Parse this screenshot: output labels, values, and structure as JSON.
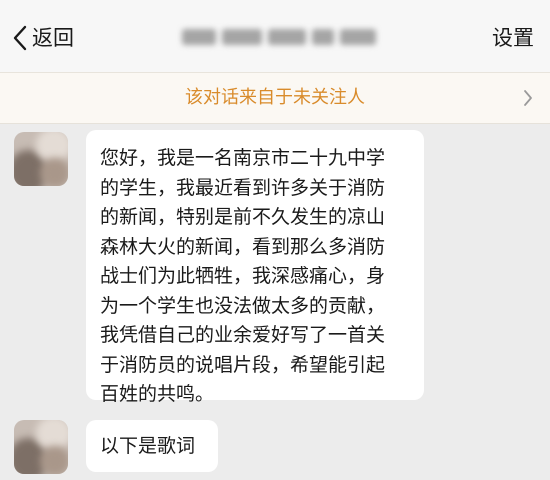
{
  "navbar": {
    "back_label": "返回",
    "settings_label": "设置"
  },
  "notice": {
    "text": "该对话来自于未关注人"
  },
  "messages": [
    {
      "lines": [
        "您好，我是一名南京市二十九中学",
        "的学生，我最近看到许多关于消防",
        "的新闻，特别是前不久发生的凉山",
        "森林大火的新闻，看到那么多消防",
        "战士们为此牺牲，我深感痛心，身",
        "为一个学生也没法做太多的贡献，",
        "我凭借自己的业余爱好写了一首关",
        "于消防员的说唱片段，希望能引起",
        "百姓的共鸣。"
      ]
    },
    {
      "lines": [
        "以下是歌词"
      ]
    }
  ],
  "colors": {
    "chat_background": "#ececec",
    "notice_text": "#d98b2b",
    "bubble": "#ffffff"
  },
  "icons": {
    "back": "chevron-left-icon",
    "notice": "chevron-right-icon"
  }
}
